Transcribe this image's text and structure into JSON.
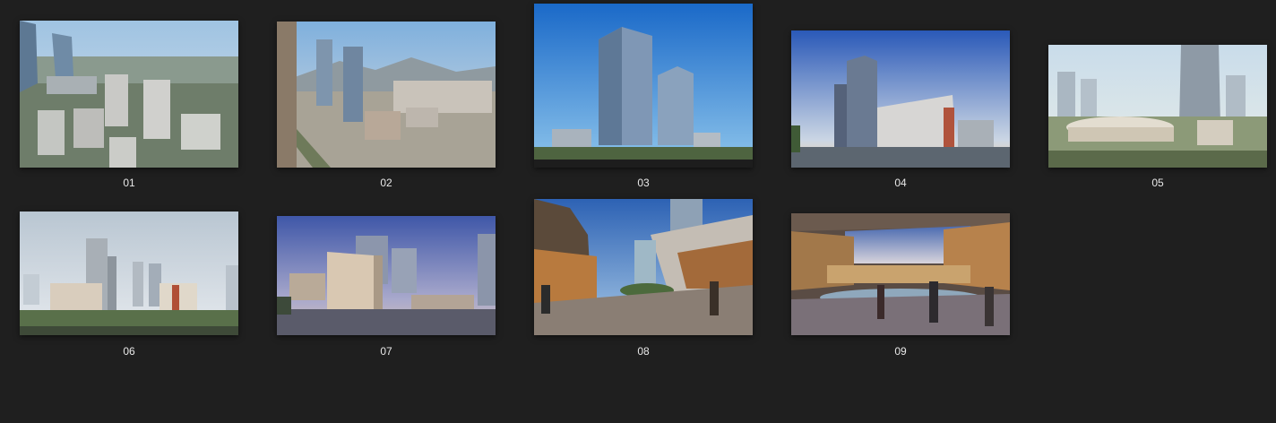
{
  "gallery": {
    "items": [
      {
        "label": "01",
        "image": "aerial-city-residential-towers"
      },
      {
        "label": "02",
        "image": "aerial-city-mountains-towers"
      },
      {
        "label": "03",
        "image": "two-glass-towers-blue-sky"
      },
      {
        "label": "04",
        "image": "office-towers-street-dusk"
      },
      {
        "label": "05",
        "image": "commercial-complex-tower"
      },
      {
        "label": "06",
        "image": "mixed-use-complex-cloudy-sky"
      },
      {
        "label": "07",
        "image": "office-building-dusk-plaza"
      },
      {
        "label": "08",
        "image": "shopping-mall-atrium-walkway"
      },
      {
        "label": "09",
        "image": "shopping-mall-interior-plaza"
      }
    ]
  },
  "colors": {
    "background": "#1f1f1f",
    "label_text": "#e8e8e8"
  }
}
